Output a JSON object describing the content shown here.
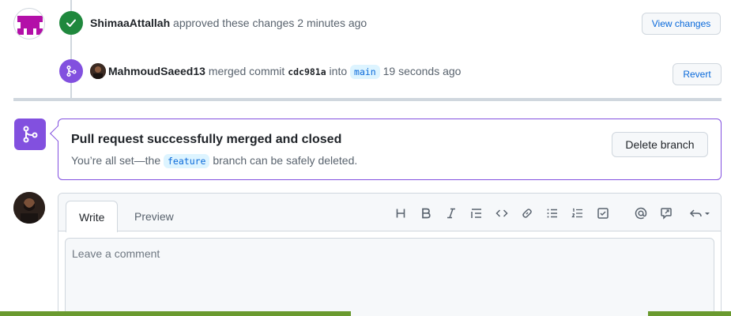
{
  "timeline": {
    "approval": {
      "user": "ShimaaAttallah",
      "action": "approved these changes",
      "time": "2 minutes ago",
      "button": "View changes"
    },
    "merge": {
      "user": "MahmoudSaeed13",
      "action": "merged commit",
      "commit": "cdc981a",
      "into": "into",
      "branch": "main",
      "time": "19 seconds ago",
      "button": "Revert"
    }
  },
  "merged_box": {
    "title": "Pull request successfully merged and closed",
    "sub_prefix": "You’re all set—the",
    "branch": "feature",
    "sub_suffix": "branch can be safely deleted.",
    "button": "Delete branch"
  },
  "comment": {
    "tabs": [
      "Write",
      "Preview"
    ],
    "placeholder": "Leave a comment",
    "toolbar": [
      "heading-icon",
      "bold-icon",
      "italic-icon",
      "quote-icon",
      "code-icon",
      "link-icon",
      "unordered-list-icon",
      "ordered-list-icon",
      "task-list-icon",
      "mention-icon",
      "reference-icon",
      "undo-icon"
    ]
  },
  "colors": {
    "approve": "#1f883d",
    "merge": "#8250df",
    "link": "#0969da"
  }
}
